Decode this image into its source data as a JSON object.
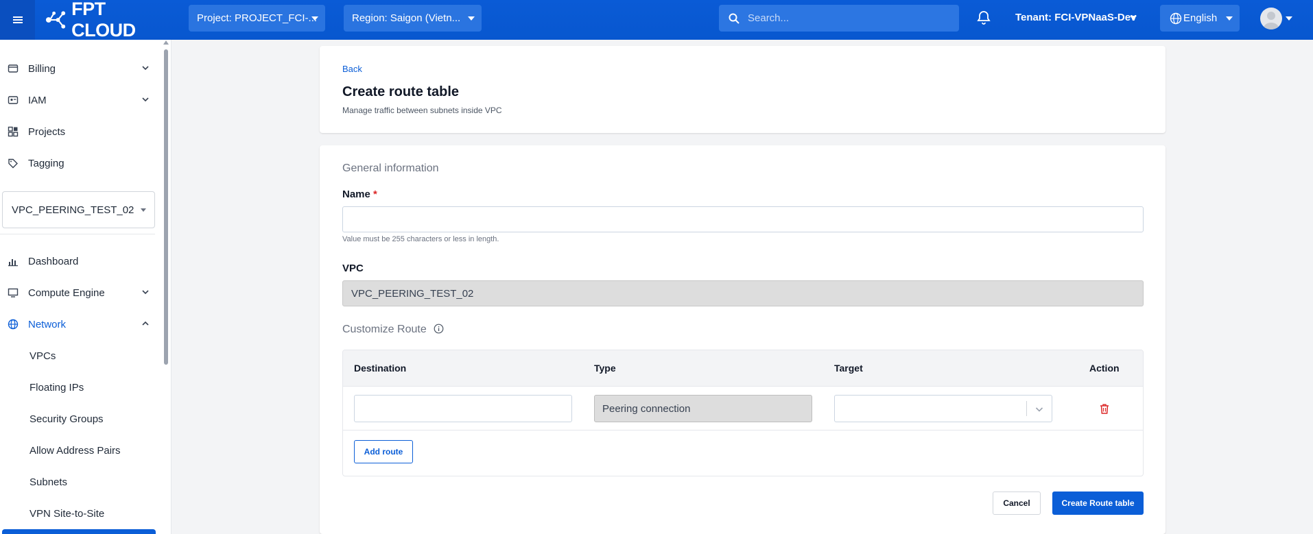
{
  "topbar": {
    "logo_text": "FPT CLOUD",
    "project_select": "Project: PROJECT_FCI-...",
    "region_select": "Region: Saigon (Vietn...",
    "search_placeholder": "Search...",
    "tenant": "Tenant: FCI-VPNaaS-Dev",
    "language": "English",
    "accent": "#0b5ed7"
  },
  "sidebar": {
    "top_items": [
      {
        "label": "Billing",
        "icon": "wallet-icon",
        "expandable": true
      },
      {
        "label": "IAM",
        "icon": "id-card-icon",
        "expandable": true
      },
      {
        "label": "Projects",
        "icon": "grid-icon",
        "expandable": false
      },
      {
        "label": "Tagging",
        "icon": "tag-icon",
        "expandable": false
      }
    ],
    "project_selector": "VPC_PEERING_TEST_02",
    "nav_items": [
      {
        "label": "Dashboard",
        "icon": "bar-chart-icon",
        "expandable": false
      },
      {
        "label": "Compute Engine",
        "icon": "monitor-icon",
        "expandable": true
      },
      {
        "label": "Network",
        "icon": "globe-icon",
        "expandable": true,
        "expanded": true
      }
    ],
    "network_children": [
      "VPCs",
      "Floating IPs",
      "Security Groups",
      "Allow Address Pairs",
      "Subnets",
      "VPN Site-to-Site"
    ]
  },
  "header": {
    "back_label": "Back",
    "title": "Create route table",
    "subtitle": "Manage traffic between subnets inside VPC"
  },
  "form": {
    "general_title": "General information",
    "name_label": "Name",
    "name_required": "*",
    "name_value": "",
    "name_hint": "Value must be 255 characters or less in length.",
    "vpc_label": "VPC",
    "vpc_value": "VPC_PEERING_TEST_02",
    "customize_title": "Customize Route",
    "table": {
      "headers": {
        "destination": "Destination",
        "type": "Type",
        "target": "Target",
        "action": "Action"
      },
      "rows": [
        {
          "destination": "",
          "type": "Peering connection",
          "target": ""
        }
      ]
    },
    "add_route_label": "Add route",
    "cancel_label": "Cancel",
    "submit_label": "Create Route table"
  }
}
